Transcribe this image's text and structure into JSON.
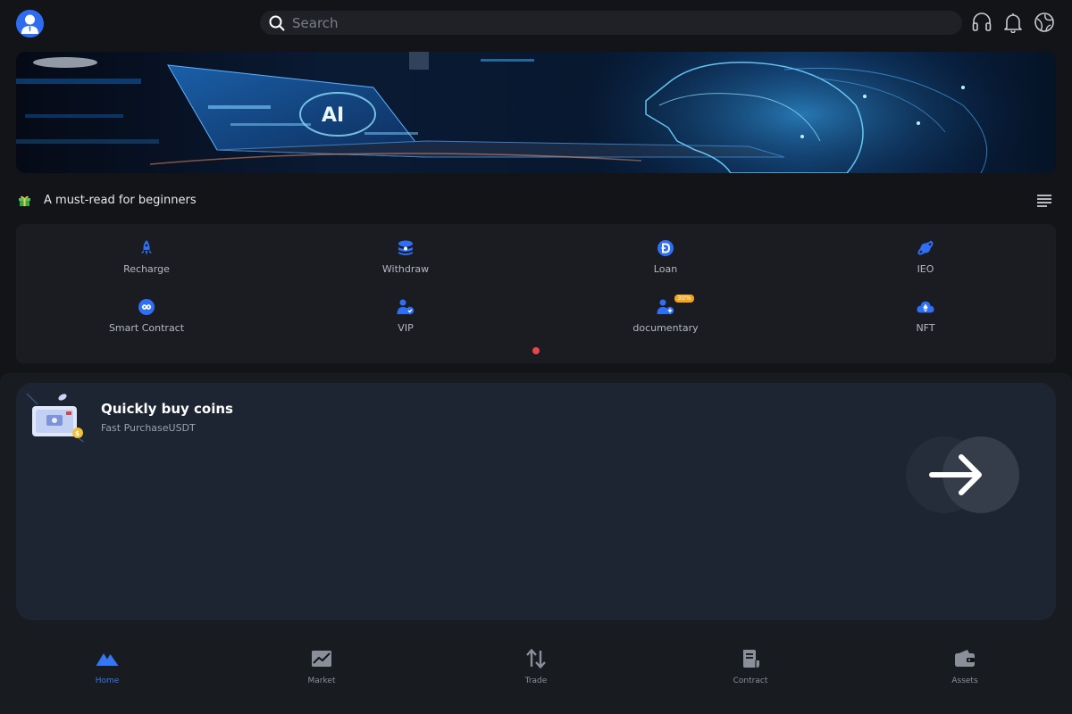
{
  "header": {
    "search_placeholder": "Search",
    "icons": [
      "headset-icon",
      "bell-icon",
      "globe-icon"
    ]
  },
  "banner": {
    "logo_text": "AI"
  },
  "notice": {
    "text": "A must-read for beginners"
  },
  "quick_menu": {
    "items": [
      {
        "label": "Recharge",
        "icon": "rocket-icon"
      },
      {
        "label": "Withdraw",
        "icon": "coin-stack-icon"
      },
      {
        "label": "Loan",
        "icon": "dollar-coin-icon"
      },
      {
        "label": "IEO",
        "icon": "planet-icon"
      },
      {
        "label": "Smart Contract",
        "icon": "exchange-icon"
      },
      {
        "label": "VIP",
        "icon": "user-check-icon"
      },
      {
        "label": "documentary",
        "icon": "user-plus-icon",
        "badge": "30%"
      },
      {
        "label": "NFT",
        "icon": "cloud-ethereum-icon"
      }
    ],
    "pagination_color": "#e8434e"
  },
  "buy_card": {
    "title": "Quickly buy coins",
    "subtitle": "Fast PurchaseUSDT"
  },
  "bottom_nav": {
    "items": [
      {
        "label": "Home",
        "icon": "home-mountain-icon",
        "active": true
      },
      {
        "label": "Market",
        "icon": "chart-icon",
        "active": false
      },
      {
        "label": "Trade",
        "icon": "arrows-updown-icon",
        "active": false
      },
      {
        "label": "Contract",
        "icon": "document-icon",
        "active": false
      },
      {
        "label": "Assets",
        "icon": "wallet-icon",
        "active": false
      }
    ]
  },
  "colors": {
    "accent": "#3577f3",
    "background": "#131417",
    "card": "#1d2532",
    "badge": "#f3a51a"
  }
}
